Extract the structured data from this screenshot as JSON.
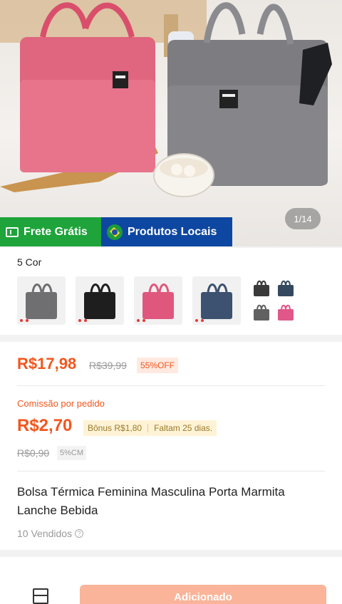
{
  "hero": {
    "image_counter": "1/14",
    "badge_free_shipping": "Frete Grátis",
    "badge_local_products": "Produtos Locais"
  },
  "colors": {
    "title": "5 Cor",
    "thumbs": [
      "gray",
      "black",
      "pink",
      "navy"
    ],
    "swatch_colors": [
      "#4a4a4a",
      "#34495e",
      "#666666",
      "#e0578a"
    ]
  },
  "price": {
    "current": "R$17,98",
    "original": "R$39,99",
    "discount": "55%OFF",
    "commission_label": "Comissão por pedido",
    "commission_value": "R$2,70",
    "bonus": "Bônus R$1,80",
    "days_left": "Faltam 25 dias.",
    "commission_old": "R$0,90",
    "commission_rate": "5%CM"
  },
  "product": {
    "title": "Bolsa Térmica Feminina Masculina Porta Marmita Lanche Bebida",
    "sold": "10 Vendidos",
    "help_icon": "?"
  },
  "bottom_bar": {
    "add_button_label": "Adicionado",
    "store_icon": "store-icon"
  },
  "theme": {
    "accent": "#f2561d",
    "free_shipping_green": "#1ea43a",
    "local_blue": "#0e47a1"
  }
}
